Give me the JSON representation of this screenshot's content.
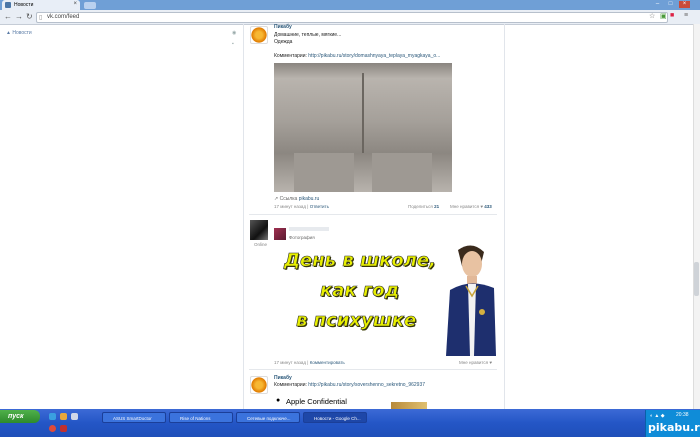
{
  "browser": {
    "tab_title": "Новости",
    "url": "vk.com/feed"
  },
  "sidebar": {
    "feed_link": "Новости"
  },
  "post1": {
    "author": "Пикабу",
    "line1": "Домашние, теплые, мягкие...",
    "line2": "Одежда",
    "comment_label": "Комментарии:",
    "comment_url": "http://pikabu.ru/story/domashnyaya_teplaya_myagkaya_o...",
    "source_label": "Ссылка",
    "source_site": "pikabu.ru",
    "time": "17 минут назад",
    "reply": "Ответить",
    "share_label": "Поделиться",
    "share_count": "21",
    "like_label": "Мне нравится",
    "like_count": "433"
  },
  "post2": {
    "status": "Online",
    "sub": "Фотография",
    "meme_line1": "День в школе,",
    "meme_line2": "как год",
    "meme_line3": "в психушке",
    "time": "17 минут назад",
    "comment": "Комментировать",
    "like_label": "Мне нравится"
  },
  "post3": {
    "author": "Пикабу",
    "comment_label": "Комментарии:",
    "comment_url": "http://pikabu.ru/story/sovershenno_sekretno_962937",
    "apple_text": "Apple Confidential"
  },
  "taskbar": {
    "start": "пуск",
    "items": [
      "ASUS SmartDoctor",
      "Rise of Nations",
      "Сетевые подключе...",
      "Новости - Google Ch..."
    ],
    "clock": "20:38",
    "watermark": "pikabu.ru"
  },
  "colors": {
    "accent": "#2b587a",
    "meme": "#e8f000"
  }
}
